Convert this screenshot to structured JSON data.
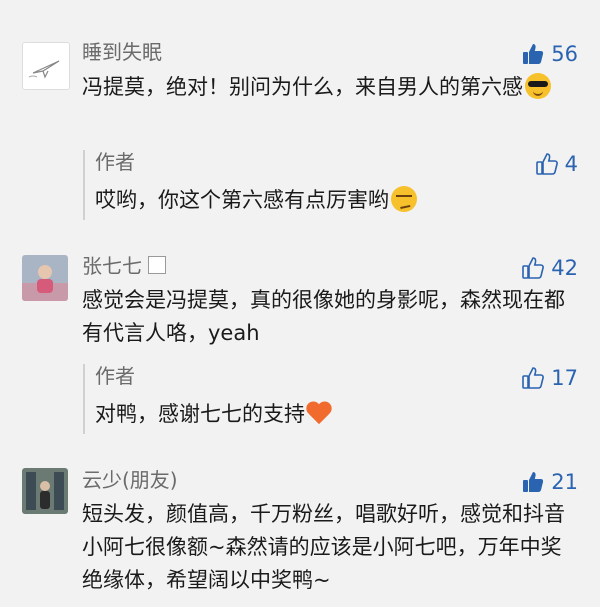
{
  "comments": [
    {
      "name": "睡到失眠",
      "likes": "56",
      "like_style": "filled",
      "text": "冯提莫，绝对！别问为什么，来自男人的第六感",
      "emoji": "cool-face-emoji",
      "reply": {
        "author": "作者",
        "likes": "4",
        "text": "哎哟，你这个第六感有点厉害哟",
        "emoji": "smirk-face-emoji"
      }
    },
    {
      "name": "张七七",
      "likes": "42",
      "like_style": "outline",
      "text": "感觉会是冯提莫，真的很像她的身影呢，森然现在都有代言人咯，yeah",
      "reply": {
        "author": "作者",
        "likes": "17",
        "text": "对鸭，感谢七七的支持",
        "emoji": "heart-emoji"
      }
    },
    {
      "name": "云少(朋友)",
      "likes": "21",
      "like_style": "filled",
      "text": "短头发，颜值高，千万粉丝，唱歌好听，感觉和抖音小阿七很像额~森然请的应该是小阿七吧，万年中奖绝缘体，希望阔以中奖鸭~"
    }
  ],
  "colors": {
    "accent": "#2a63b0",
    "background": "#f2f2f2",
    "secondary_text": "#6b6b6b"
  }
}
